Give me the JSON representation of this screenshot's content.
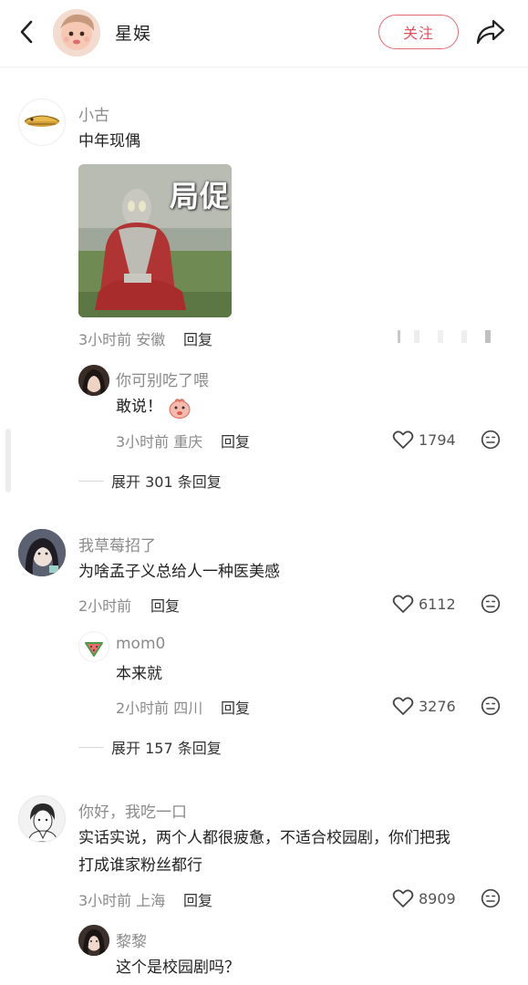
{
  "header": {
    "title": "星娱",
    "follow_label": "关注"
  },
  "comments": [
    {
      "username": "小古",
      "text": "中年现偶",
      "meme_text": "局促",
      "meta": "3小时前 安徽",
      "reply_label": "回复",
      "replies": [
        {
          "username": "你可别吃了喂",
          "text": "敢说！",
          "meta": "3小时前 重庆",
          "reply_label": "回复",
          "likes": "1794"
        }
      ],
      "expand_label": "展开 301 条回复"
    },
    {
      "username": "我草莓招了",
      "text": "为啥孟子义总给人一种医美感",
      "meta": "2小时前",
      "reply_label": "回复",
      "likes": "6112",
      "replies": [
        {
          "username": "mom0",
          "text": "本来就",
          "meta": "2小时前 四川",
          "reply_label": "回复",
          "likes": "3276"
        }
      ],
      "expand_label": "展开 157 条回复"
    },
    {
      "username": "你好，我吃一口",
      "text_line1": "实话实说，两个人都很疲惫，不适合校园剧，你们把我",
      "text_line2": "打成谁家粉丝都行",
      "meta": "3小时前 上海",
      "reply_label": "回复",
      "likes": "8909",
      "replies": [
        {
          "username": "黎黎",
          "text": "这个是校园剧吗？"
        }
      ]
    }
  ],
  "colors": {
    "accent": "#e4505c",
    "secondary_text": "#8a8a8a",
    "primary_text": "#222222"
  }
}
